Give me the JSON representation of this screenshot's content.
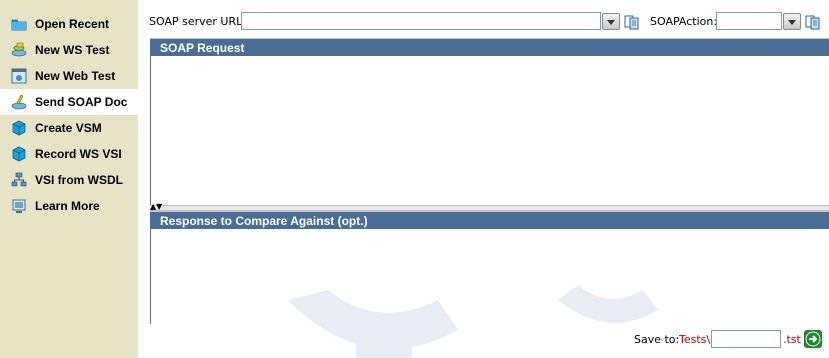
{
  "sidebar": {
    "items": [
      {
        "label": "Open Recent",
        "icon": "folder-icon"
      },
      {
        "label": "New WS Test",
        "icon": "ws-test-icon"
      },
      {
        "label": "New Web Test",
        "icon": "web-test-icon"
      },
      {
        "label": "Send SOAP Doc",
        "icon": "soap-doc-icon",
        "active": true
      },
      {
        "label": "Create VSM",
        "icon": "cube-icon"
      },
      {
        "label": "Record WS VSI",
        "icon": "cube-icon"
      },
      {
        "label": "VSI from WSDL",
        "icon": "network-icon"
      },
      {
        "label": "Learn More",
        "icon": "monitor-icon"
      }
    ]
  },
  "toolbar": {
    "url_label": "SOAP server URL:",
    "url_value": "",
    "action_label": "SOAPAction:",
    "action_value": ""
  },
  "request_panel": {
    "title": "SOAP Request"
  },
  "response_panel": {
    "title": "Response to Compare Against (opt.)"
  },
  "save": {
    "label": "Save to:",
    "prefix": "Tests\\",
    "filename": "",
    "extension": ".tst"
  },
  "colors": {
    "sidebar_bg": "#e6e4c6",
    "panel_header": "#496d94",
    "accent_red": "#cc0000",
    "go_green": "#1b8a2e"
  }
}
